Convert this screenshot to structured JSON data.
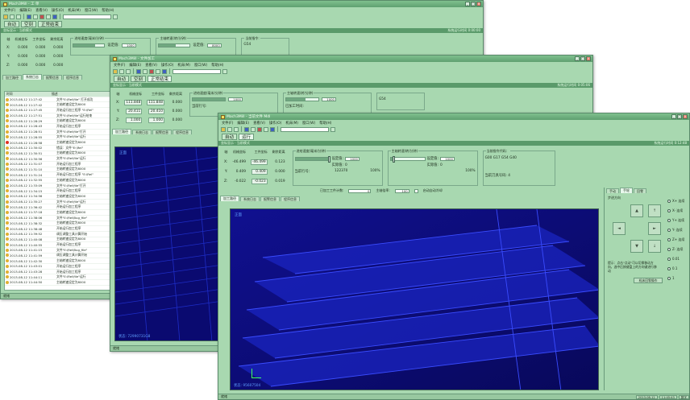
{
  "win1": {
    "title": "Mach3Mill - 工 单",
    "menu": [
      "文件(F)",
      "编辑(E)",
      "查看(V)",
      "操作(O)",
      "机床(M)",
      "窗口(W)",
      "帮助(H)"
    ],
    "modes": [
      "自动",
      "空刻",
      "正常结束"
    ],
    "section": "坐标显示 · 当前模式",
    "section_right": "系统运行时间 0:00:00",
    "axes": [
      {
        "name": "X:",
        "machine": "0.000",
        "work": "0.000",
        "remain": "0.000"
      },
      {
        "name": "Y:",
        "machine": "0.000",
        "work": "0.000",
        "remain": "0.000"
      },
      {
        "name": "Z:",
        "machine": "0.000",
        "work": "0.000",
        "remain": "0.000"
      }
    ],
    "col_headers": [
      "轴",
      "机械坐标",
      "工件坐标",
      "剩余距离"
    ],
    "feed_label": "进给速度(毫米/分钟)",
    "feed_set_label": "设定值:",
    "feed_set": "1000",
    "spindle_label": "主轴转速(转/分钟)",
    "spindle_set_label": "设定值:",
    "spindle_set": "8000",
    "cmd_label": "当前指令:",
    "cmd_value": "G54",
    "tabs": [
      "加工路径",
      "系统日志",
      "报警信息",
      "程序信息"
    ],
    "log_headers": [
      "时间",
      "描述"
    ],
    "log": [
      {
        "t": "2013-08-12 11:27:42",
        "d": "文件\"E:\\Rel\\file\" 打开成功",
        "err": false
      },
      {
        "t": "2013-08-12 11:27:42",
        "d": "主轴转速设定为8000",
        "err": false
      },
      {
        "t": "2013-08-12 11:27:45",
        "d": "开始运行加工程序 \"E:\\Rel\"",
        "err": false
      },
      {
        "t": "2013-08-12 11:27:51",
        "d": "文件\"E:\\Rel\\file\"运行结束",
        "err": false
      },
      {
        "t": "2013-08-12 11:28:29",
        "d": "主轴转速设定为8000",
        "err": false
      },
      {
        "t": "2013-08-12 11:28:43",
        "d": "开始运行加工程序",
        "err": false
      },
      {
        "t": "2013-08-12 11:28:51",
        "d": "文件\"E:\\Rel\\file\"打开",
        "err": false
      },
      {
        "t": "2013-08-12 11:28:55",
        "d": "文件\"E:\\Rel\\file\"运行",
        "err": false
      },
      {
        "t": "2013-08-12 11:28:58",
        "d": "主轴转速设定为8000",
        "err": true
      },
      {
        "t": "2013-08-12 11:30:02",
        "d": "错误：文件\"E:\\Rel\"",
        "err": false
      },
      {
        "t": "2013-08-12 11:30:51",
        "d": "主轴转速设定为8000",
        "err": false
      },
      {
        "t": "2013-08-12 11:30:56",
        "d": "文件\"E:\\Rel\\file\"运行",
        "err": false
      },
      {
        "t": "2013-08-12 11:31:07",
        "d": "开始运行加工程序",
        "err": false
      },
      {
        "t": "2013-08-12 11:31:10",
        "d": "主轴转速设定为8000",
        "err": false
      },
      {
        "t": "2013-08-12 11:31:24",
        "d": "开始运行加工程序 \"E:\\Rel\"",
        "err": false
      },
      {
        "t": "2013-08-12 11:32:55",
        "d": "主轴转速设定为8000",
        "err": false
      },
      {
        "t": "2013-08-12 11:33:09",
        "d": "文件\"E:\\Rel\\file\"打开",
        "err": false
      },
      {
        "t": "2013-08-12 11:34:15",
        "d": "开始运行加工程序",
        "err": false
      },
      {
        "t": "2013-08-12 11:34:56",
        "d": "主轴转速设定为8000",
        "err": false
      },
      {
        "t": "2013-08-12 11:35:27",
        "d": "文件\"E:\\Rel\\file\"运行",
        "err": false
      },
      {
        "t": "2013-08-12 11:36:42",
        "d": "开始运行加工程序",
        "err": false
      },
      {
        "t": "2013-08-12 11:37:18",
        "d": "主轴转速设定为8000",
        "err": false
      },
      {
        "t": "2013-08-12 11:38:06",
        "d": "文件\"E:\\Rel\\Bug_file\"",
        "err": false
      },
      {
        "t": "2013-08-12 11:38:32",
        "d": "主轴转速设定为8000",
        "err": false
      },
      {
        "t": "2013-08-12 11:38:48",
        "d": "开始运行加工程序",
        "err": false
      },
      {
        "t": "2013-08-12 11:39:52",
        "d": "调压调整工具计算开始",
        "err": false
      },
      {
        "t": "2013-08-12 11:40:08",
        "d": "主轴转速设定为8000",
        "err": false
      },
      {
        "t": "2013-08-12 11:40:55",
        "d": "开始运行加工程序",
        "err": false
      },
      {
        "t": "2013-08-12 11:41:15",
        "d": "文件\"E:\\Rel\\Bug_file\"",
        "err": false
      },
      {
        "t": "2013-08-12 11:41:59",
        "d": "调压调整工具计算开始",
        "err": false
      },
      {
        "t": "2013-08-12 11:42:30",
        "d": "主轴转速设定为8000",
        "err": false
      },
      {
        "t": "2013-08-12 11:43:01",
        "d": "开始运行加工程序",
        "err": false
      },
      {
        "t": "2013-08-12 11:43:28",
        "d": "开始运行加工程序",
        "err": false
      },
      {
        "t": "2013-08-12 11:44:11",
        "d": "文件\"E:\\Rel\\file\"运行",
        "err": false
      },
      {
        "t": "2013-08-12 11:44:50",
        "d": "主轴转速设定为8000",
        "err": false
      }
    ],
    "status": "就绪"
  },
  "win2": {
    "title": "Mach3Mill - 文件加工",
    "menu": [
      "文件(F)",
      "编辑(E)",
      "查看(V)",
      "操作(O)",
      "机床(M)",
      "窗口(W)",
      "帮助(H)"
    ],
    "modes": [
      "自动",
      "空刻",
      "正常结束"
    ],
    "section": "坐标显示 · 当前模式",
    "section_right": "系统运行时间 0:05:06",
    "axes": [
      {
        "name": "X:",
        "machine": "111.848",
        "work": "111.848",
        "remain": "0.000"
      },
      {
        "name": "Y:",
        "machine": "20.411",
        "work": "20.410",
        "remain": "0.000"
      },
      {
        "name": "Z:",
        "machine": "1.000",
        "work": "1.000",
        "remain": "0.000"
      }
    ],
    "col_headers": [
      "轴",
      "机械坐标",
      "工件坐标",
      "剩余距离"
    ],
    "feed_label": "进给速度(毫米/分钟)",
    "feed_set": "1000",
    "spindle_label": "主轴转速(转/分钟)",
    "spindle_set": "1000",
    "cmd_value": "G54",
    "extra_label": "当前行号:",
    "work_label": "已加工时间:",
    "tabs": [
      "加工路径",
      "系统日志",
      "报警信息",
      "程序信息"
    ],
    "view_tl": "正面",
    "view_bl": "状态: 72990731G8",
    "status": "就绪"
  },
  "win3": {
    "title": "Mach3Mill - 当前文件 Mdl",
    "menu": [
      "文件(F)",
      "编辑(E)",
      "查看(V)",
      "操作(O)",
      "机床(M)",
      "窗口(W)",
      "帮助(H)"
    ],
    "modes": [
      "自动",
      "运行"
    ],
    "section": "坐标显示 · 当前模式",
    "section_right": "系统运行时间 0:12:48",
    "axes": [
      {
        "name": "X:",
        "machine": "-46.499",
        "work": "-46.499",
        "remain": "0.123"
      },
      {
        "name": "Y:",
        "machine": "0.409",
        "work": "0.409",
        "remain": "0.000"
      },
      {
        "name": "Z:",
        "machine": "-0.022",
        "work": "-0.023",
        "remain": "0.019"
      }
    ],
    "col_headers": [
      "轴",
      "机械坐标",
      "工件坐标",
      "剩余距离"
    ],
    "feed_label": "进给速度(毫米/分钟)",
    "feed_set_label": "设定值:",
    "feed_set": "1000",
    "feed_actual_label": "实际值:",
    "feed_actual": "0",
    "feed_pct": "100%",
    "spindle_label": "主轴转速(转/分钟)",
    "spindle_set_label": "设定值:",
    "spindle_set": "1000",
    "spindle_actual_label": "实际值:",
    "spindle_actual": "0",
    "spindle_pct": "100%",
    "cmd_label": "当前指令代码：",
    "cmd_value": "G00 G17 G54 G40",
    "line_label": "当前行号：",
    "line_value": "122370",
    "worktime_label": "已加工工件计数:",
    "worktime_value": "0",
    "spindle_mult_label": "主轴倍率:",
    "spindle_mult": "100",
    "cooling_label": "启动自动冷却",
    "tool_label": "当前刀具号码: 4",
    "tabs": [
      "加工路径",
      "系统日志",
      "报警信息",
      "程序信息"
    ],
    "side_tabs": [
      "手动",
      "手轮",
      "回零"
    ],
    "side_title": "步进方向",
    "side_hint": "提示：点击\"点动\"可以切换移动方向，选中后按键盘上的方向键进行移动",
    "side_btn": "机床回零操作",
    "radio_labels": [
      "X+ 连续",
      "X- 连续",
      "Y+ 连续",
      "Y- 连续",
      "Z+ 连续",
      "Z- 连续",
      "0.01",
      "0.1",
      "1"
    ],
    "view_tl": "正面",
    "view_bl": "状态: 95607504",
    "status": "就绪",
    "status_cells": [
      "2013-08-12",
      "11:45:43",
      "数字"
    ]
  }
}
